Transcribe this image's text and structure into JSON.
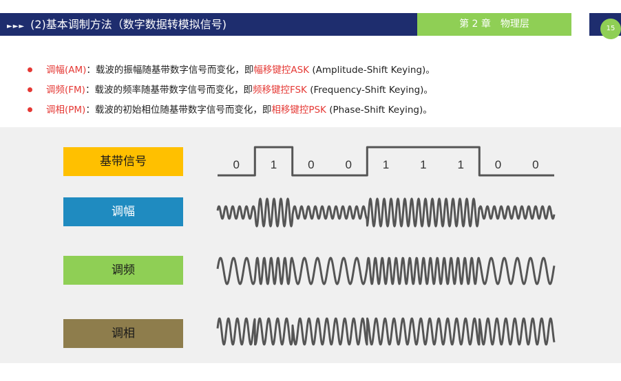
{
  "header": {
    "arrows": "►►►",
    "title": "(2)基本调制方法（数字数据转模拟信号)",
    "chapter": "第 2 章　物理层",
    "page_number": "15",
    "colors": {
      "title_bg": "#1e2d6e",
      "chapter_bg": "#8fcf55"
    }
  },
  "bullets": [
    {
      "term": "调幅(AM)",
      "desc": "：载波的振幅随基带数字信号而变化，即",
      "keying": "幅移键控ASK",
      "english": " (Amplitude-Shift Keying)。"
    },
    {
      "term": "调频(FM)",
      "desc": "：载波的频率随基带数字信号而变化，即",
      "keying": "频移键控FSK",
      "english": " (Frequency-Shift Keying)。"
    },
    {
      "term": "调相(PM)",
      "desc": "：载波的初始相位随基带数字信号而变化，即",
      "keying": "相移键控PSK",
      "english": " (Phase-Shift Keying)。"
    }
  ],
  "diagram": {
    "labels": {
      "baseband": "基带信号",
      "am": "调幅",
      "fm": "调频",
      "pm": "调相"
    },
    "bits": [
      "0",
      "1",
      "0",
      "0",
      "1",
      "1",
      "1",
      "0",
      "0"
    ],
    "colors": {
      "baseband": "#ffc000",
      "am": "#1f8bc0",
      "fm": "#8fcf55",
      "pm": "#8e7d4c",
      "wave": "#555555",
      "bullet_dot": "#e53935"
    }
  }
}
